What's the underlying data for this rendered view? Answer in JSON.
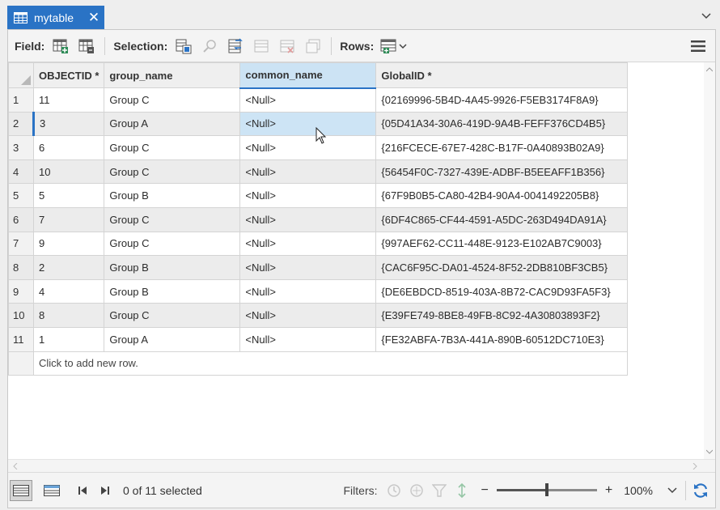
{
  "tab": {
    "title": "mytable",
    "icon": "table-icon",
    "close_glyph": "✕"
  },
  "toolbar": {
    "field_label": "Field:",
    "selection_label": "Selection:",
    "rows_label": "Rows:",
    "field_icons": [
      "add-field-icon",
      "calculate-field-icon"
    ],
    "selection_icons": [
      "select-by-attributes-icon",
      "zoom-to-selection-icon",
      "switch-selection-icon",
      "clear-selection-icon",
      "delete-selection-icon",
      "copy-selection-icon"
    ],
    "rows_icon": "add-row-icon"
  },
  "columns": [
    "",
    "OBJECTID *",
    "group_name",
    "common_name",
    "GlobalID *"
  ],
  "selected_column": "common_name",
  "rows": [
    {
      "num": "1",
      "objectid": "11",
      "group": "Group C",
      "common": "<Null>",
      "globalid": "{02169996-5B4D-4A45-9926-F5EB3174F8A9}"
    },
    {
      "num": "2",
      "objectid": "3",
      "group": "Group A",
      "common": "<Null>",
      "globalid": "{05D41A34-30A6-419D-9A4B-FEFF376CD4B5}"
    },
    {
      "num": "3",
      "objectid": "6",
      "group": "Group C",
      "common": "<Null>",
      "globalid": "{216FCECE-67E7-428C-B17F-0A40893B02A9}"
    },
    {
      "num": "4",
      "objectid": "10",
      "group": "Group C",
      "common": "<Null>",
      "globalid": "{56454F0C-7327-439E-ADBF-B5EEAFF1B356}"
    },
    {
      "num": "5",
      "objectid": "5",
      "group": "Group B",
      "common": "<Null>",
      "globalid": "{67F9B0B5-CA80-42B4-90A4-0041492205B8}"
    },
    {
      "num": "6",
      "objectid": "7",
      "group": "Group C",
      "common": "<Null>",
      "globalid": "{6DF4C865-CF44-4591-A5DC-263D494DA91A}"
    },
    {
      "num": "7",
      "objectid": "9",
      "group": "Group C",
      "common": "<Null>",
      "globalid": "{997AEF62-CC11-448E-9123-E102AB7C9003}"
    },
    {
      "num": "8",
      "objectid": "2",
      "group": "Group B",
      "common": "<Null>",
      "globalid": "{CAC6F95C-DA01-4524-8F52-2DB810BF3CB5}"
    },
    {
      "num": "9",
      "objectid": "4",
      "group": "Group B",
      "common": "<Null>",
      "globalid": "{DE6EBDCD-8519-403A-8B72-CAC9D93FA5F3}"
    },
    {
      "num": "10",
      "objectid": "8",
      "group": "Group C",
      "common": "<Null>",
      "globalid": "{E39FE749-8BE8-49FB-8C92-4A30803893F2}"
    },
    {
      "num": "11",
      "objectid": "1",
      "group": "Group A",
      "common": "<Null>",
      "globalid": "{FE32ABFA-7B3A-441A-890B-60512DC710E3}"
    }
  ],
  "active_row": "2",
  "add_row_text": "Click to add new row.",
  "status": {
    "selected_text": "0 of 11 selected",
    "filters_label": "Filters:",
    "zoom_minus": "−",
    "zoom_plus": "+",
    "zoom_value": "100%",
    "zoom_level": 0.5
  },
  "colors": {
    "accent": "#2a73c5",
    "selected_header": "#cce3f4",
    "selected_cell": "#cde4f5"
  }
}
